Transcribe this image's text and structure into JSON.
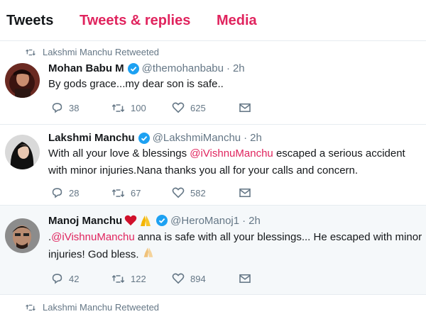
{
  "tabs": [
    {
      "label": "Tweets",
      "active": true
    },
    {
      "label": "Tweets & replies",
      "active": false
    },
    {
      "label": "Media",
      "active": false
    }
  ],
  "colors": {
    "accent": "#e0245e",
    "verified": "#1da1f2",
    "muted": "#657786",
    "text": "#14171a"
  },
  "tweets": [
    {
      "retweeted_by": "Lakshmi Manchu Retweeted",
      "name": "Mohan Babu M",
      "handle": "@themohanbabu",
      "dot": "·",
      "time": "2h",
      "text": "By gods grace...my dear son is safe..",
      "replies": "38",
      "retweets": "100",
      "likes": "625"
    },
    {
      "name": "Lakshmi Manchu",
      "handle": "@LakshmiManchu",
      "dot": "·",
      "time": "2h",
      "text_before": "With all your love & blessings ",
      "mention": "@iVishnuManchu",
      "text_after": " escaped a serious accident with minor injuries.Nana thanks you all for your calls and concern.",
      "replies": "28",
      "retweets": "67",
      "likes": "582"
    },
    {
      "name": "Manoj Manchu",
      "handle": "@HeroManoj1",
      "dot": "·",
      "time": "2h",
      "text_prefix": ".",
      "mention": "@iVishnuManchu",
      "text_after": " anna is safe with all your blessings... He escaped with minor injuries! God bless. ",
      "replies": "42",
      "retweets": "122",
      "likes": "894"
    },
    {
      "retweeted_by": "Lakshmi Manchu Retweeted"
    }
  ]
}
